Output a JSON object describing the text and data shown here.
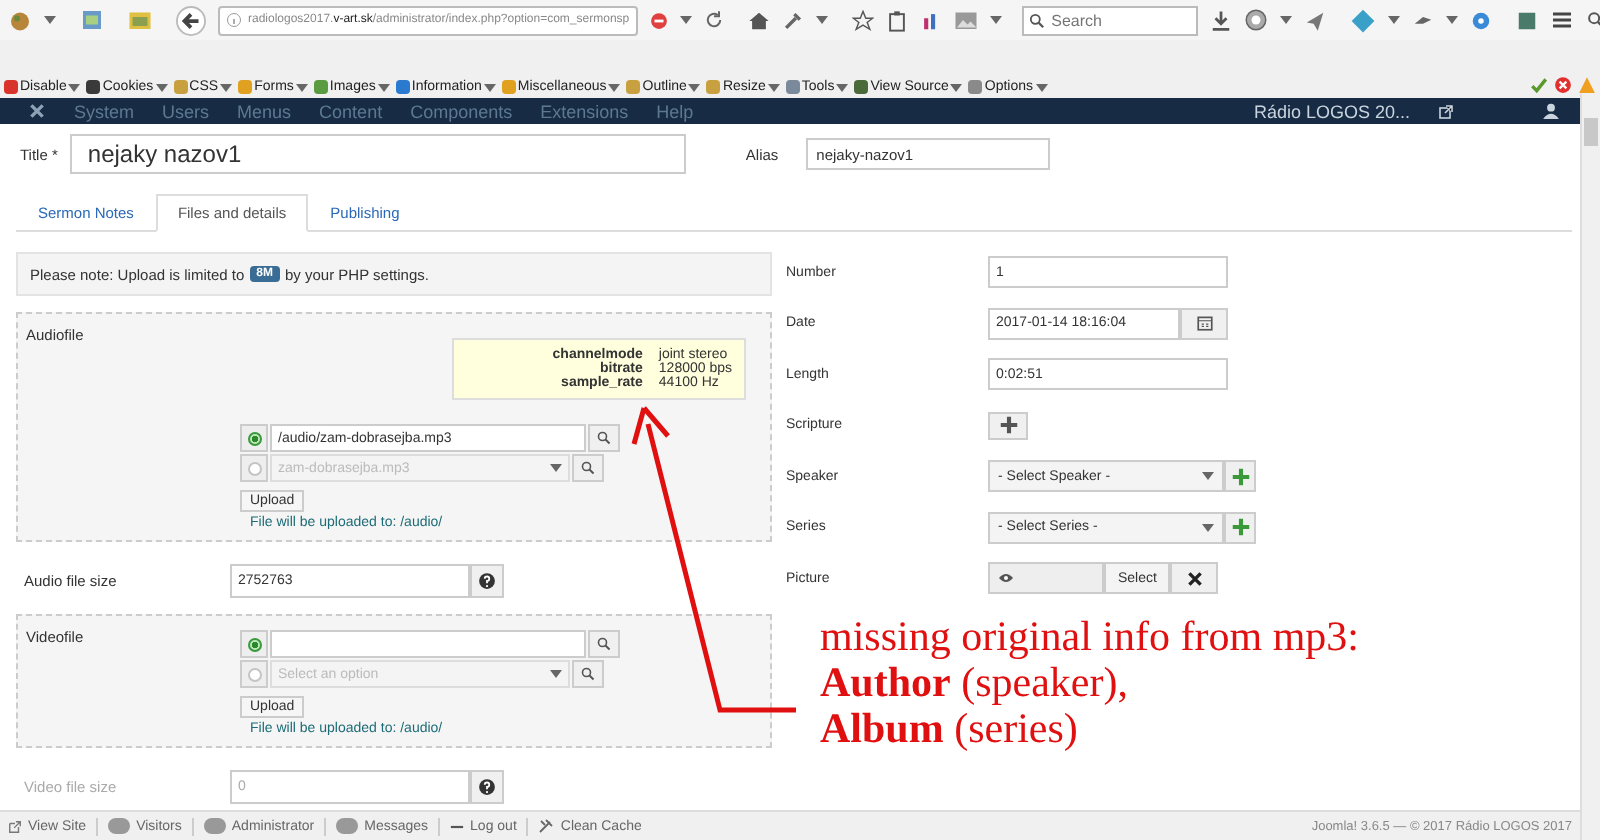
{
  "browser": {
    "url_prefix": "radiologos2017.",
    "url_domain": "v-art.sk",
    "url_path": "/administrator/index.php?option=com_sermonsp",
    "search": {
      "placeholder": "Search"
    }
  },
  "dev_toolbar": {
    "items": [
      {
        "label": "Disable",
        "color": "#d9342b"
      },
      {
        "label": "Cookies",
        "color": "#3a3a3a"
      },
      {
        "label": "CSS",
        "color": "#c8a040"
      },
      {
        "label": "Forms",
        "color": "#e0a020"
      },
      {
        "label": "Images",
        "color": "#5a9a40"
      },
      {
        "label": "Information",
        "color": "#2a7ad0"
      },
      {
        "label": "Miscellaneous",
        "color": "#e0a020"
      },
      {
        "label": "Outline",
        "color": "#c8a040"
      },
      {
        "label": "Resize",
        "color": "#c8a040"
      },
      {
        "label": "Tools",
        "color": "#7a8a9a"
      },
      {
        "label": "View Source",
        "color": "#4a6a3a"
      },
      {
        "label": "Options",
        "color": "#8a8a8a"
      }
    ]
  },
  "menu": {
    "items": [
      "System",
      "Users",
      "Menus",
      "Content",
      "Components",
      "Extensions",
      "Help"
    ],
    "site": "Rádio LOGOS 20..."
  },
  "title": {
    "label": "Title *",
    "value": "nejaky nazov1"
  },
  "alias": {
    "label": "Alias",
    "value": "nejaky-nazov1"
  },
  "tabs": [
    {
      "label": "Sermon Notes",
      "selected": false
    },
    {
      "label": "Files and details",
      "selected": true
    },
    {
      "label": "Publishing",
      "selected": false
    }
  ],
  "notice": {
    "before": "Please note: Upload is limited to",
    "badge": "8M",
    "after": "by your PHP settings."
  },
  "audiofile": {
    "label": "Audiofile",
    "tooltip": [
      {
        "key": "channelmode",
        "value": "joint stereo"
      },
      {
        "key": "bitrate",
        "value": "128000 bps"
      },
      {
        "key": "sample_rate",
        "value": "44100 Hz"
      }
    ],
    "sources": [
      {
        "kind": "input",
        "value": "/audio/zam-dobrasejba.mp3",
        "selected": true
      },
      {
        "kind": "select",
        "value": "zam-dobrasejba.mp3",
        "disabled": true,
        "selected": false
      }
    ],
    "upload": "Upload",
    "note": "File will be uploaded to: /audio/"
  },
  "audio_size": {
    "label": "Audio file size",
    "value": "2752763"
  },
  "videofile": {
    "label": "Videofile",
    "sources": [
      {
        "kind": "input",
        "selected": true
      },
      {
        "kind": "select",
        "placeholder": "Select an option",
        "disabled": true,
        "selected": false
      }
    ],
    "upload": "Upload",
    "note": "File will be uploaded to: /audio/"
  },
  "video_size": {
    "label": "Video file size",
    "value": "0",
    "disabled": true
  },
  "details": [
    {
      "kind": "text",
      "label": "Number",
      "value": "1"
    },
    {
      "kind": "date",
      "label": "Date",
      "value": "2017-01-14 18:16:04"
    },
    {
      "kind": "text",
      "label": "Length",
      "value": "0:02:51"
    },
    {
      "kind": "add",
      "label": "Scripture"
    },
    {
      "kind": "select",
      "label": "Speaker",
      "value": "- Select Speaker -"
    },
    {
      "kind": "select",
      "label": "Series",
      "value": "- Select Series -"
    },
    {
      "kind": "image",
      "label": "Picture",
      "button": "Select"
    }
  ],
  "annotation": {
    "lines": [
      "missing original info from mp3:",
      "**Author** (speaker),",
      "**Album** (series)"
    ]
  },
  "status_bar": {
    "items": [
      {
        "kind": "link",
        "label": "View Site"
      },
      {
        "kind": "count",
        "label": "Visitors"
      },
      {
        "kind": "count",
        "label": "Administrator"
      },
      {
        "kind": "count",
        "label": "Messages"
      },
      {
        "kind": "logout",
        "label": "Log out"
      },
      {
        "kind": "clean",
        "label": "Clean Cache"
      }
    ],
    "footer": "Joomla! 3.6.5 — © 2017 Rádio LOGOS 2017"
  }
}
